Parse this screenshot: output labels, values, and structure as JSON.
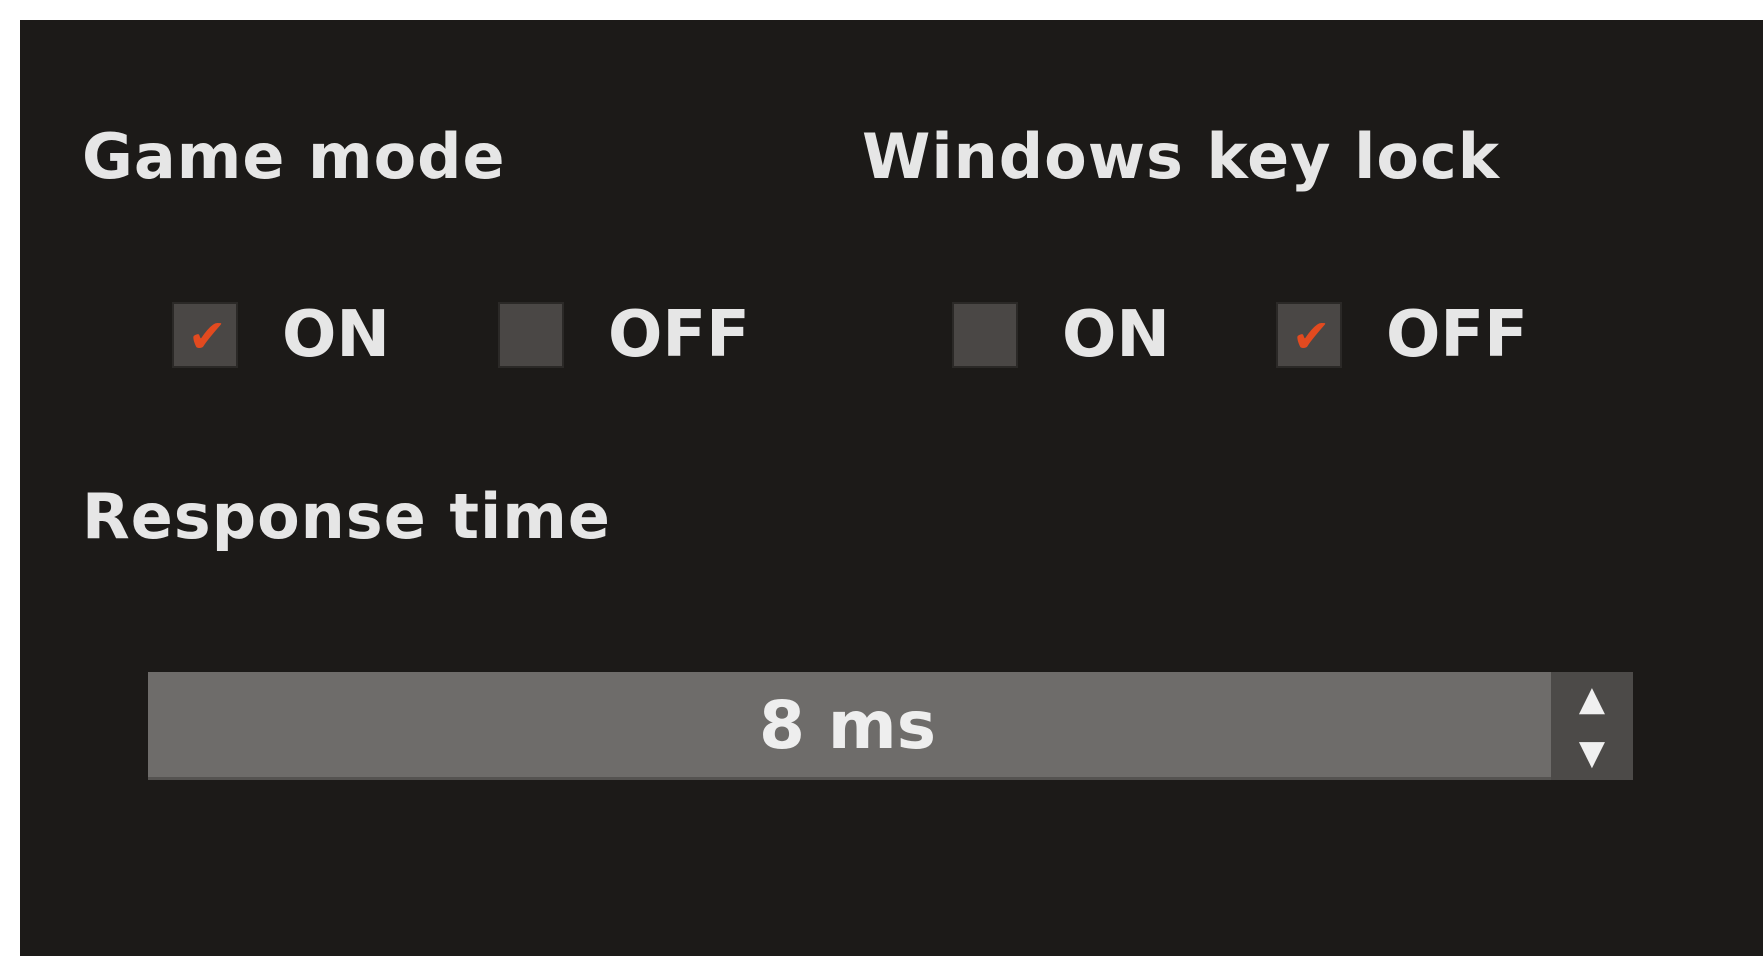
{
  "game_mode": {
    "title": "Game mode",
    "on_label": "ON",
    "off_label": "OFF",
    "selected": "ON"
  },
  "windows_key_lock": {
    "title": "Windows key lock",
    "on_label": "ON",
    "off_label": "OFF",
    "selected": "OFF"
  },
  "response_time": {
    "title": "Response time",
    "value": "8 ms",
    "up_glyph": "▲",
    "down_glyph": "▼"
  },
  "checkmark_glyph": "✔",
  "colors": {
    "panel_background": "#1c1a18",
    "checkbox_fill": "#4a4745",
    "checkmark": "#e24a1f",
    "text": "#e6e6e6",
    "spinbox_fill": "#6e6c6a"
  },
  "icons": {
    "checkbox_checked": "checkmark-icon",
    "spin_up": "triangle-up-icon",
    "spin_down": "triangle-down-icon"
  }
}
